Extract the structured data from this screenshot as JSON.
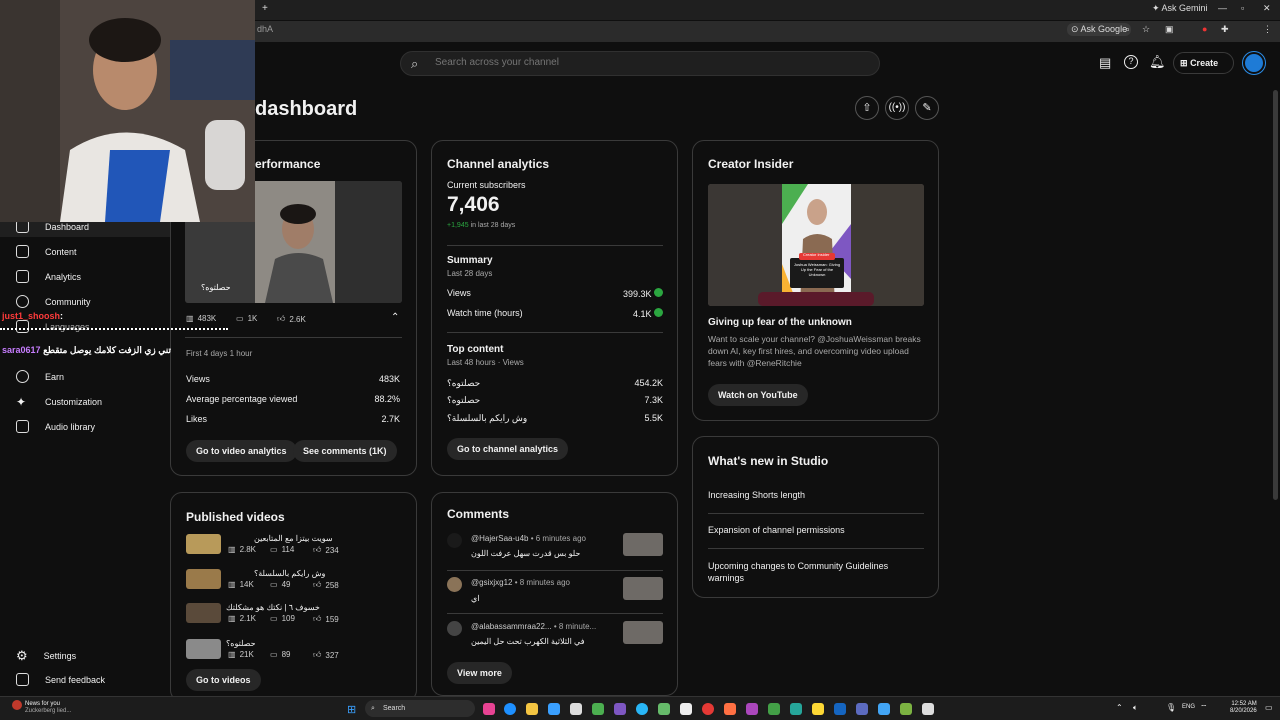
{
  "browser": {
    "address_fragment": "dhA",
    "ask_gemini": "Ask Gemini",
    "ask_google": "Ask Google"
  },
  "search": {
    "placeholder": "Search across your channel"
  },
  "header": {
    "create_label": "Create",
    "page_title": "dashboard"
  },
  "sidebar": {
    "items": [
      {
        "label": "Dashboard",
        "icon": "dashboard-icon"
      },
      {
        "label": "Content",
        "icon": "content-icon"
      },
      {
        "label": "Analytics",
        "icon": "analytics-icon"
      },
      {
        "label": "Community",
        "icon": "community-icon"
      },
      {
        "label": "Languages",
        "icon": "languages-icon"
      },
      {
        "label": "Earn",
        "icon": "earn-icon"
      },
      {
        "label": "Customization",
        "icon": "customization-icon"
      },
      {
        "label": "Audio library",
        "icon": "audio-library-icon"
      }
    ],
    "settings": "Settings",
    "feedback": "Send feedback"
  },
  "chat": {
    "line1_user": "just1_shoosh",
    "line1_colon": ":",
    "line2_user": "sara0617",
    "line2_text": "تني زي الزفت كلامك يوصل متقطع"
  },
  "performance": {
    "title": "erformance",
    "thumb_caption": "حصلتوه؟",
    "views": "483K",
    "comments": "1K",
    "likes": "2.6K",
    "period": "First 4 days 1 hour",
    "rows": [
      {
        "label": "Views",
        "value": "483K"
      },
      {
        "label": "Average percentage viewed",
        "value": "88.2%"
      },
      {
        "label": "Likes",
        "value": "2.7K"
      }
    ],
    "btn_analytics": "Go to video analytics",
    "btn_comments": "See comments (1K)"
  },
  "analytics": {
    "title": "Channel analytics",
    "subs_label": "Current subscribers",
    "subs_value": "7,406",
    "subs_delta": "+1,945",
    "subs_delta_suffix": "in last 28 days",
    "summary_title": "Summary",
    "summary_period": "Last 28 days",
    "summary_rows": [
      {
        "label": "Views",
        "value": "399.3K"
      },
      {
        "label": "Watch time (hours)",
        "value": "4.1K"
      }
    ],
    "top_title": "Top content",
    "top_period": "Last 48 hours · Views",
    "top_rows": [
      {
        "label": "حصلتوه؟",
        "value": "454.2K"
      },
      {
        "label": "حصلتوه؟",
        "value": "7.3K"
      },
      {
        "label": "وش رايكم بالسلسلة؟",
        "value": "5.5K"
      }
    ],
    "btn": "Go to channel analytics"
  },
  "insider": {
    "title": "Creator Insider",
    "badge": "Creator Insider",
    "thumb_text": "Joshua Weissman: Giving Up the Fear of the Unknown",
    "video_title": "Giving up fear of the unknown",
    "desc": "Want to scale your channel? @JoshuaWeissman breaks down AI, key first hires, and overcoming video upload fears with @ReneRitchie",
    "btn": "Watch on YouTube"
  },
  "whats_new": {
    "title": "What's new in Studio",
    "items": [
      "Increasing Shorts length",
      "Expansion of channel permissions",
      "Upcoming changes to Community Guidelines warnings"
    ]
  },
  "published": {
    "title": "Published videos",
    "videos": [
      {
        "title": "سويت بيتزا مع المتابعين",
        "views": "2.8K",
        "comments": "114",
        "likes": "234"
      },
      {
        "title": "وش رايكم بالسلسلة؟",
        "views": "14K",
        "comments": "49",
        "likes": "258"
      },
      {
        "title": "خسوف ٦ | نكتك هو مشكلتك",
        "views": "2.1K",
        "comments": "109",
        "likes": "159"
      },
      {
        "title": "حصلتوه؟",
        "views": "21K",
        "comments": "89",
        "likes": "327"
      }
    ],
    "btn": "Go to videos"
  },
  "comments": {
    "title": "Comments",
    "items": [
      {
        "user": "@HajerSaa-u4b",
        "time": "• 6 minutes ago",
        "text": "حلو بس قدرت سهل عرفت اللون"
      },
      {
        "user": "@gsixjxg12",
        "time": "• 8 minutes ago",
        "text": "اي"
      },
      {
        "user": "@alabassammraa22...",
        "time": "• 8 minute...",
        "text": "في الثلاثية الكهرب تحت حل اليمين"
      }
    ],
    "btn": "View more"
  },
  "taskbar": {
    "news_title": "News for you",
    "news_sub": "Zuckerberg lied...",
    "search": "Search",
    "lang": "ENG",
    "time": "12:52 AM",
    "date": "8/20/2026"
  },
  "colors": {
    "accent_green": "#2ba640",
    "chat_red": "#ff3b3b",
    "chat_purple": "#c77dff"
  }
}
